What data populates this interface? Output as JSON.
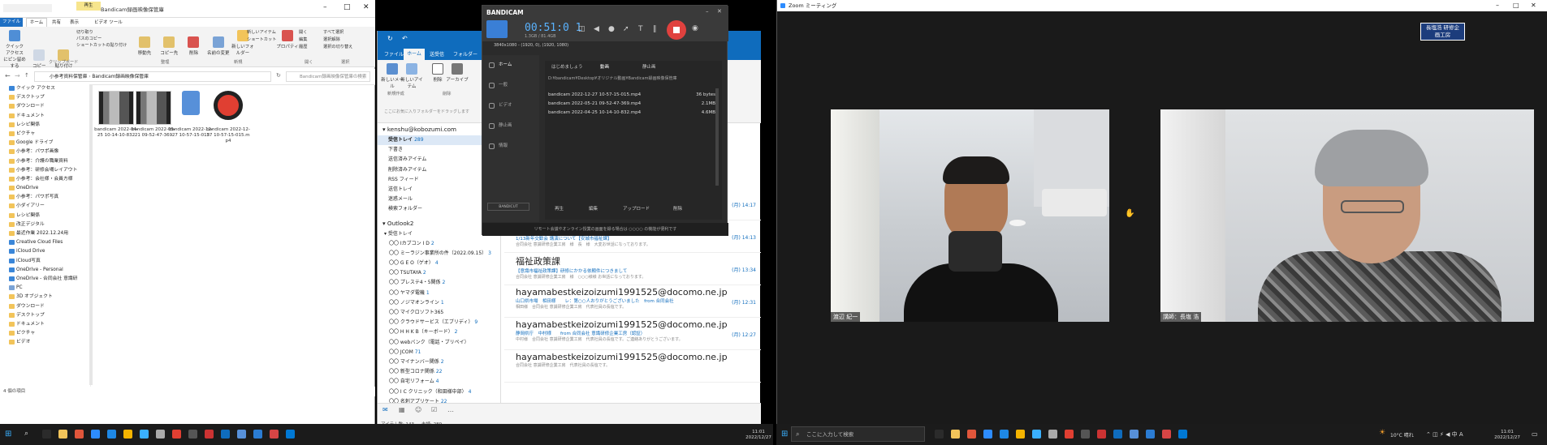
{
  "explorer": {
    "title": "Bandicam録画映像保管庫",
    "ribbon_tabs": [
      "ファイル",
      "ホーム",
      "共有",
      "表示",
      "ビデオ ツール"
    ],
    "manage_tab": "再生",
    "groups": [
      "クリップボード",
      "整理",
      "新規",
      "開く",
      "選択"
    ],
    "buttons": {
      "pin": "クイック アクセス にピン留めする",
      "copy": "コピー",
      "paste": "貼り付け",
      "cut": "切り取り",
      "copy_path": "パスのコピー",
      "paste_shortcut": "ショートカットの貼り付け",
      "move_to": "移動先",
      "copy_to": "コピー先",
      "delete": "削除",
      "rename": "名前の変更",
      "new_folder": "新しいフォルダー",
      "new_item": "新しいアイテム",
      "easy_access": "ショートカット",
      "properties": "プロパティ",
      "open": "開く",
      "edit": "編集",
      "history": "履歴",
      "select_all": "すべて選択",
      "select_none": "選択解除",
      "invert": "選択の切り替え"
    },
    "breadcrumb": [
      "小参考資料保管庫",
      "Bandicam録画映像保管庫"
    ],
    "search_placeholder": "Bandicam録画映像保管庫の検索",
    "nav": [
      "クイック アクセス",
      "デスクトップ",
      "ダウンロード",
      "ドキュメント",
      "レシピ関係",
      "ピクチャ",
      "Google ドライブ",
      "小参考：パワポ画像",
      "小参考：介護の職業資料",
      "小参考：研修会場レイアウト",
      "小参考：会社様・会員方様",
      "OneDrive",
      "小参考：パワポ写真",
      "小ダイアリー",
      "レシピ関係",
      "改正デジタル",
      "最近作業 2022.12.24用",
      "Creative Cloud Files",
      "iCloud Drive",
      "iCloud写真",
      "OneDrive - Personal",
      "OneDrive - 合同会社 意識研",
      "PC",
      "3D オブジェクト",
      "ダウンロード",
      "デスクトップ",
      "ドキュメント",
      "ピクチャ",
      "ビデオ"
    ],
    "files": [
      {
        "name": "bandicam 2022-04-25 10-14-10-832",
        "type": "video"
      },
      {
        "name": "bandicam 2022-05-21 09-52-47-369",
        "type": "video"
      },
      {
        "name": "bandicam 2022-12-27 10-57-15-015",
        "type": "audio"
      },
      {
        "name": "bandicam 2022-12-27 10-57-15-015.mp4",
        "type": "bandicam"
      }
    ],
    "status": "4 個の項目"
  },
  "outlook": {
    "ribbon_tabs": [
      "ファイル",
      "ホーム",
      "送受信",
      "フォルダー"
    ],
    "buttons": [
      "新しいメール",
      "新しいアイテム",
      "削除",
      "アーカイブ"
    ],
    "group_label": "新規作成",
    "delete_group": "削除",
    "drop_hint": "ここにお気に入りフォルダーをドラッグします",
    "account": "kenshu@kobozumi.com",
    "folders_top": [
      {
        "name": "受信トレイ",
        "count": "289"
      },
      {
        "name": "下書き",
        "count": ""
      },
      {
        "name": "送信済みアイテム",
        "count": ""
      },
      {
        "name": "削除済みアイテム",
        "count": ""
      },
      {
        "name": "RSS フィード",
        "count": ""
      },
      {
        "name": "送信トレイ",
        "count": ""
      },
      {
        "name": "迷惑メール",
        "count": ""
      },
      {
        "name": "検索フォルダー",
        "count": ""
      }
    ],
    "account2": "Outlook2",
    "inbox2": "受信トレイ",
    "folders_sub": [
      {
        "name": "〇〇 Iカブコン I D",
        "count": "2"
      },
      {
        "name": "〇〇 ミーラジン事業所の件（2022.09.15）",
        "count": "3"
      },
      {
        "name": "〇〇 G E O（ゲオ）",
        "count": "4"
      },
      {
        "name": "〇〇 TSUTAYA",
        "count": "2"
      },
      {
        "name": "〇〇 プレステ4・5関係",
        "count": "2"
      },
      {
        "name": "〇〇 ヤマダ電機",
        "count": "1"
      },
      {
        "name": "〇〇 ノジマオンライン",
        "count": "1"
      },
      {
        "name": "〇〇 マイクロソフト365",
        "count": ""
      },
      {
        "name": "〇〇 クラウドサービス（エブリディ）",
        "count": "9"
      },
      {
        "name": "〇〇 H H K B（キーボード）",
        "count": "2"
      },
      {
        "name": "〇〇 webバンク（電話・ブリペイ）",
        "count": ""
      },
      {
        "name": "〇〇 JCOM",
        "count": "71"
      },
      {
        "name": "〇〇 マイナンバー関係",
        "count": "2"
      },
      {
        "name": "〇〇 新型コロナ関係",
        "count": "22"
      },
      {
        "name": "〇〇 自宅リフォーム",
        "count": "4"
      },
      {
        "name": "〇〇 I C クリニック（和田様中部）",
        "count": "4"
      },
      {
        "name": "〇〇 名刺アプリケート",
        "count": "22"
      }
    ],
    "mails": [
      {
        "from": "hayamabestkeizoizumi1991525@docomo.ne.jp",
        "subject": "新潟市福祉事務所課　森様様　　from 合同会社 意識研修会様工房（認証）",
        "date": "(月) 14:17",
        "preview": "森様様　合同会社 意識研修企業工房　代表社員の長塩です。ご存知かと思いますが…"
      },
      {
        "from": "社会福祉課",
        "subject": "1/13新年交歓会 講演について【安城市福祉課】",
        "date": "(月) 14:13",
        "preview": "合同会社 意識研修企業工房　様　長　様　大変お世話になっております。"
      },
      {
        "from": "福祉政策課",
        "subject": "【意識市福祉政策課】研修にかかる依頼件につきまして",
        "date": "(月) 13:34",
        "preview": "合同会社 意識研修企業工房　様　○○○様様 お世話になっております。"
      },
      {
        "from": "hayamabestkeizoizumi1991525@docomo.ne.jp",
        "subject": "山口県市場　相田様　　レ：第○○人おりがとうございました　from 合同会社",
        "date": "(月) 12:31",
        "preview": "相田様　合同会社 意識研修企業工房　代表社員の長塩です。"
      },
      {
        "from": "hayamabestkeizoizumi1991525@docomo.ne.jp",
        "subject": "静岡県庁　中村様　　from 合同会社 意識研修企業工房（認証）",
        "date": "(月) 12:27",
        "preview": "中村様　合同会社 意識研修企業工房　代表社員の長塩です。ご連絡ありがとうございます。"
      },
      {
        "from": "hayamabestkeizoizumi1991525@docomo.ne.jp",
        "subject": "",
        "date": "",
        "preview": "合同会社 意識研修企業工房　代表社員の長塩です。"
      }
    ],
    "status_items": "アイテム数: 143",
    "status_unread": "未読: 289"
  },
  "bandicam": {
    "logo": "BANDICAM",
    "timer": "00:51:0 1",
    "size": "1.3GB / 81.4GB",
    "resolution": "3840x1080 - (1920, 0), (1920, 1080)",
    "tabs": [
      "はじめましょう",
      "動画",
      "静止画"
    ],
    "folder": "D:¥bandicam¥Desktop¥オリジナル動画¥Bandicam録画映像保管庫",
    "side": [
      "ホーム",
      "一般",
      "ビデオ",
      "静止画",
      "情報"
    ],
    "files": [
      {
        "name": "bandicam 2022-12-27 10-57-15-015.mp4",
        "size": "36 bytes"
      },
      {
        "name": "bandicam 2022-05-21 09-52-47-369.mp4",
        "size": "2.1MB"
      },
      {
        "name": "bandicam 2022-04-25 10-14-10-832.mp4",
        "size": "4.6MB"
      }
    ],
    "actions": [
      "再生",
      "編集",
      "アップロード",
      "削除"
    ],
    "footer": "リモート会議やオンライン授業の画面を録る場合は ○○○○ の機能が便利です",
    "upgrade": "BANDICUT"
  },
  "zoom": {
    "title": "Zoom ミーティング",
    "left_name": "渡辺 紀一",
    "right_name": "講師：長塩 浩",
    "banner": "長塩浩 研修企画工房"
  },
  "taskbar_left": {
    "time": "11:01",
    "date": "2022/12/27"
  },
  "taskbar_right": {
    "search": "ここに入力して検索",
    "weather": "10°C 晴れ",
    "time": "11:01",
    "date": "2022/12/27"
  }
}
